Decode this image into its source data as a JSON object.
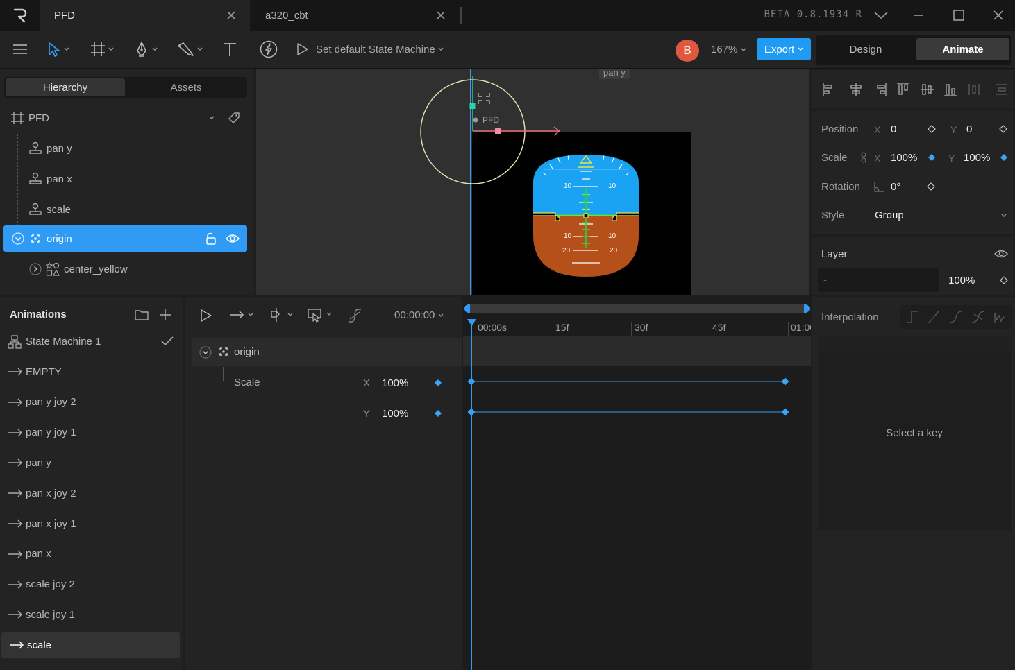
{
  "tabs": [
    {
      "label": "PFD",
      "active": true
    },
    {
      "label": "a320_cbt",
      "active": false
    }
  ],
  "version_label": "BETA 0.8.1934 R",
  "toolbar": {
    "state_machine_label": "Set default State Machine",
    "avatar_initial": "B",
    "zoom": "167%",
    "export_label": "Export",
    "modes": [
      "Design",
      "Animate"
    ],
    "active_mode": "Animate"
  },
  "left_tabs": [
    "Hierarchy",
    "Assets"
  ],
  "hierarchy": {
    "root": "PFD",
    "items": [
      {
        "label": "pan y"
      },
      {
        "label": "pan x"
      },
      {
        "label": "scale"
      },
      {
        "label": "origin",
        "selected": true
      },
      {
        "label": "center_yellow"
      }
    ]
  },
  "canvas": {
    "artboard_label": "pan y",
    "origin_label": "PFD",
    "sky_color": "#1aa3f2",
    "ground_color": "#b5501b",
    "pitch_labels": {
      "up": "10",
      "down_10": "10",
      "down_20": "20"
    }
  },
  "inspector": {
    "position_label": "Position",
    "position_x": "0",
    "position_y": "0",
    "scale_label": "Scale",
    "scale_x": "100%",
    "scale_y": "100%",
    "rotation_label": "Rotation",
    "rotation": "0°",
    "style_label": "Style",
    "style_value": "Group",
    "layer_label": "Layer",
    "layer_blend": "-",
    "layer_opacity": "100%",
    "axis_x": "X",
    "axis_y": "Y"
  },
  "animations": {
    "title": "Animations",
    "state_machine": "State Machine 1",
    "items": [
      {
        "label": "EMPTY"
      },
      {
        "label": "pan y joy 2"
      },
      {
        "label": "pan y joy 1"
      },
      {
        "label": "pan y"
      },
      {
        "label": "pan x joy 2"
      },
      {
        "label": "pan x joy 1"
      },
      {
        "label": "pan x"
      },
      {
        "label": "scale joy 2"
      },
      {
        "label": "scale joy 1"
      },
      {
        "label": "scale",
        "selected": true
      }
    ]
  },
  "timeline": {
    "time": "00:00:00",
    "ruler": [
      "00:00s",
      "15f",
      "30f",
      "45f",
      "01:00"
    ],
    "object": "origin",
    "property": "Scale",
    "x_label": "X",
    "x_value": "100%",
    "y_label": "Y",
    "y_value": "100%"
  },
  "interpolation": {
    "title": "Interpolation",
    "empty_message": "Select a key"
  },
  "colors": {
    "accent": "#2f9bf5",
    "avatar": "#e0593f",
    "keyframe": "#3aa4f5"
  }
}
